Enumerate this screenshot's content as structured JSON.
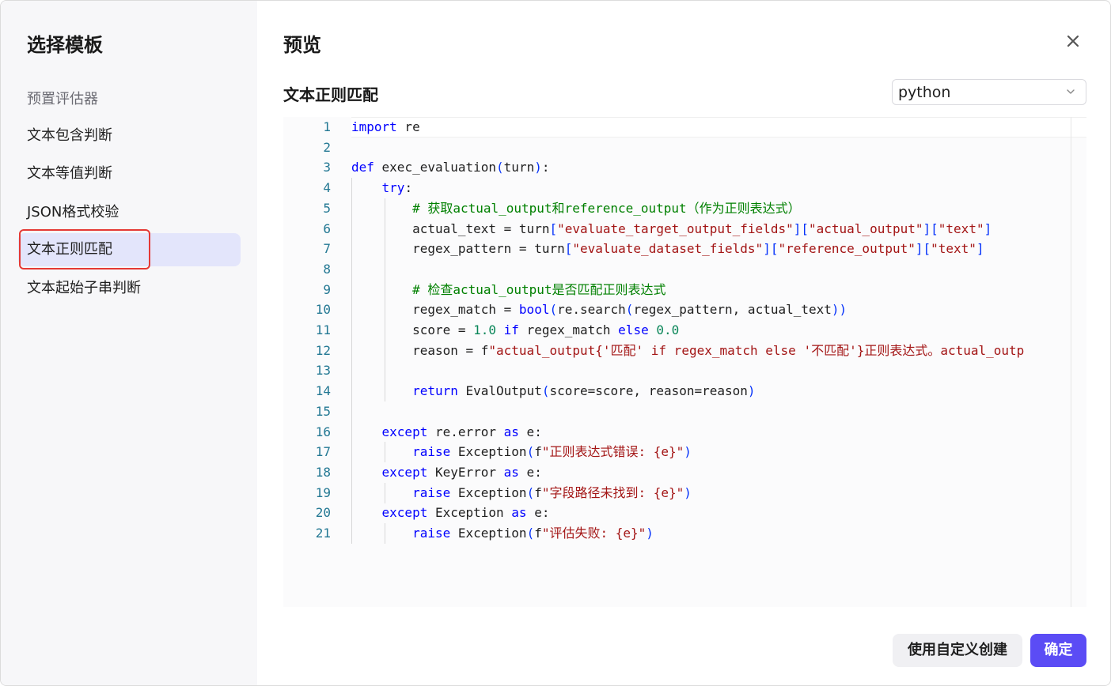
{
  "sidebar": {
    "title": "选择模板",
    "section_label": "预置评估器",
    "items": [
      {
        "label": "文本包含判断"
      },
      {
        "label": "文本等值判断"
      },
      {
        "label": "JSON格式校验"
      },
      {
        "label": "文本正则匹配"
      },
      {
        "label": "文本起始子串判断"
      }
    ],
    "active_index": 3
  },
  "main": {
    "title": "预览",
    "section_title": "文本正则匹配",
    "language_select": {
      "value": "python"
    }
  },
  "editor": {
    "line_numbers": [
      "1",
      "2",
      "3",
      "4",
      "5",
      "6",
      "7",
      "8",
      "9",
      "10",
      "11",
      "12",
      "13",
      "14",
      "15",
      "16",
      "17",
      "18",
      "19",
      "20",
      "21"
    ],
    "lines": [
      "import re",
      "",
      "def exec_evaluation(turn):",
      "    try:",
      "        # 获取actual_output和reference_output（作为正则表达式）",
      "        actual_text = turn[\"evaluate_target_output_fields\"][\"actual_output\"][\"text\"]",
      "        regex_pattern = turn[\"evaluate_dataset_fields\"][\"reference_output\"][\"text\"]",
      "",
      "        # 检查actual_output是否匹配正则表达式",
      "        regex_match = bool(re.search(regex_pattern, actual_text))",
      "        score = 1.0 if regex_match else 0.0",
      "        reason = f\"actual_output{'匹配' if regex_match else '不匹配'}正则表达式。actual_outp",
      "",
      "        return EvalOutput(score=score, reason=reason)",
      "",
      "    except re.error as e:",
      "        raise Exception(f\"正则表达式错误: {e}\")",
      "    except KeyError as e:",
      "        raise Exception(f\"字段路径未找到: {e}\")",
      "    except Exception as e:",
      "        raise Exception(f\"评估失败: {e}\")"
    ]
  },
  "footer": {
    "custom_button": "使用自定义创建",
    "confirm_button": "确定"
  },
  "colors": {
    "accent": "#5b4cf5",
    "active_item_bg": "#e3e5fb",
    "highlight_border": "#e53935"
  },
  "icons": {
    "close": "close-icon",
    "select_arrow": "chevron-down-icon"
  }
}
